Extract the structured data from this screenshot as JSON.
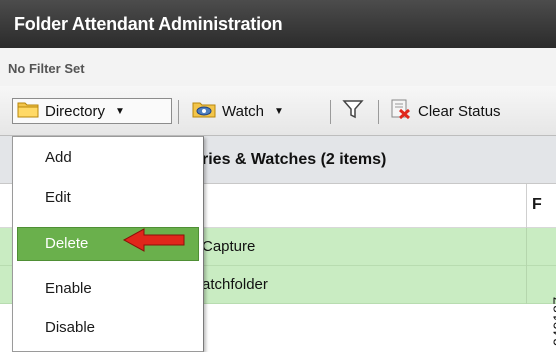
{
  "window": {
    "title": "Folder Attendant Administration"
  },
  "filter": {
    "status": "No Filter Set"
  },
  "toolbar": {
    "directory_label": "Directory",
    "watch_label": "Watch",
    "clear_status_label": "Clear Status"
  },
  "section": {
    "title": "Directories & Watches (2 items)",
    "visible_title": "ries & Watches (2 items)"
  },
  "table": {
    "columns": [
      "F"
    ],
    "rows": [
      {
        "name": "Capture"
      },
      {
        "name": "atchfolder"
      }
    ]
  },
  "menu": {
    "items": [
      {
        "label": "Add"
      },
      {
        "label": "Edit"
      },
      {
        "label": "Delete",
        "selected": true
      },
      {
        "label": "Enable"
      },
      {
        "label": "Disable"
      }
    ]
  },
  "watermark": {
    "text": "249187"
  },
  "colors": {
    "title_bg": "#3a3a3a",
    "row_bg": "#c9ecc2",
    "selected_menu": "#6ab04c",
    "arrow": "#e0261b"
  }
}
